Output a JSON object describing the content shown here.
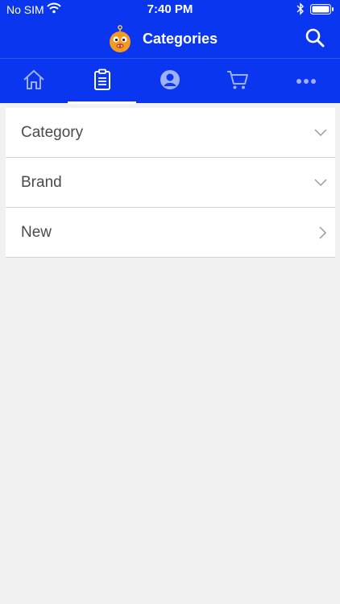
{
  "status_bar": {
    "carrier": "No SIM",
    "time": "7:40 PM"
  },
  "nav": {
    "title": "Categories",
    "logo_icon": "monster-logo-icon",
    "search_icon": "search-icon"
  },
  "tabs": [
    {
      "icon": "home-icon",
      "active": false
    },
    {
      "icon": "clipboard-icon",
      "active": true
    },
    {
      "icon": "account-icon",
      "active": false
    },
    {
      "icon": "cart-icon",
      "active": false
    },
    {
      "icon": "more-icon",
      "active": false
    }
  ],
  "list": {
    "items": [
      {
        "label": "Category",
        "chevron": "chevron-down-icon"
      },
      {
        "label": "Brand",
        "chevron": "chevron-down-icon"
      },
      {
        "label": "New",
        "chevron": "chevron-right-icon"
      }
    ]
  },
  "colors": {
    "primary": "#0a36f0",
    "tab_icon": "#9fb0ff",
    "background": "#f1f1f1",
    "text": "#4a4a4a"
  }
}
